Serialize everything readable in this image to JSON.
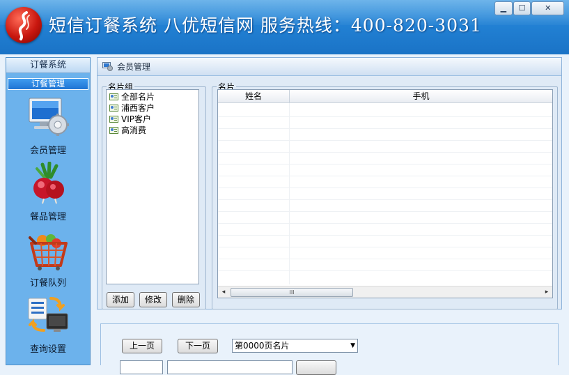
{
  "window": {
    "title": "短信订餐系统  八优短信网  服务热线：400-820-3031",
    "controls": {
      "minimize": "▁",
      "maximize": "☐",
      "close": "✕"
    }
  },
  "sidebar": {
    "header": "订餐系统",
    "section": "订餐管理",
    "items": [
      {
        "label": "会员管理",
        "icon": "member-computer-gear-icon"
      },
      {
        "label": "餐品管理",
        "icon": "radish-icon"
      },
      {
        "label": "订餐队列",
        "icon": "shopping-basket-icon"
      },
      {
        "label": "查询设置",
        "icon": "query-settings-icon"
      }
    ]
  },
  "main": {
    "panel_title": "会员管理",
    "groups": {
      "legend": "名片组",
      "items": [
        "全部名片",
        "浦西客户",
        "VIP客户",
        "高消费"
      ],
      "buttons": {
        "add": "添加",
        "edit": "修改",
        "delete": "删除"
      }
    },
    "cards": {
      "legend": "名片",
      "columns": [
        "姓名",
        "手机"
      ],
      "scroll_thumb_grip": "III",
      "scroll_left": "◂",
      "scroll_right": "▸"
    }
  },
  "pager": {
    "prev": "上一页",
    "next": "下一页",
    "page_select": "第0000页名片"
  },
  "colors": {
    "header_blue": "#2281d4",
    "sidebar_blue": "#6cb2ec",
    "section_blue": "#1f74d3"
  }
}
